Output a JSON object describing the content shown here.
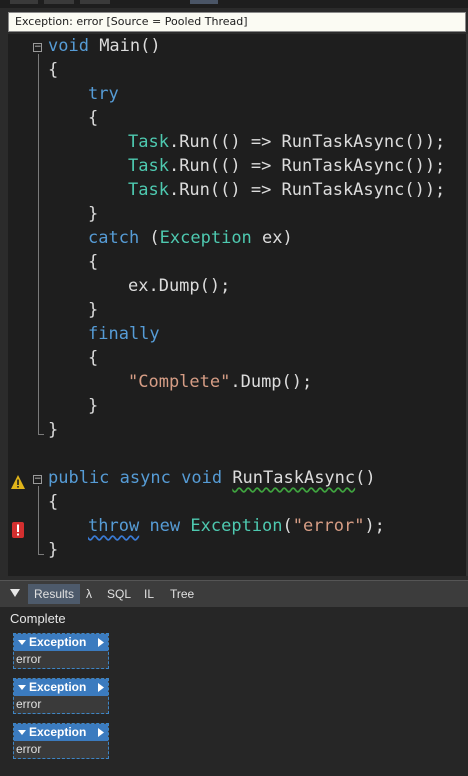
{
  "tooltip": {
    "text": "Exception: error [Source = Pooled Thread]"
  },
  "code": {
    "l1": [
      "void",
      " Main()"
    ],
    "l2": "{",
    "l3": "try",
    "l4": "{",
    "l5": [
      "Task",
      ".Run(() => RunTaskAsync());"
    ],
    "l6": [
      "Task",
      ".Run(() => RunTaskAsync());"
    ],
    "l7": [
      "Task",
      ".Run(() => RunTaskAsync());"
    ],
    "l8": "}",
    "l9": [
      "catch",
      " (",
      "Exception",
      " ex)"
    ],
    "l10": "{",
    "l11": "ex.Dump();",
    "l12": "}",
    "l13": "finally",
    "l14": "{",
    "l15": [
      "\"Complete\"",
      ".Dump();"
    ],
    "l16": "}",
    "l17": "}",
    "l18": [
      "public",
      " ",
      "async",
      " ",
      "void",
      " ",
      "RunTaskAsync",
      "()"
    ],
    "l19": "{",
    "l20": [
      "throw",
      " ",
      "new",
      " ",
      "Exception",
      "(",
      "\"error\"",
      ");"
    ],
    "l21": "}"
  },
  "panel": {
    "tabs": [
      "Results",
      "λ",
      "SQL",
      "IL",
      "Tree"
    ],
    "active_tab": "Results"
  },
  "results": {
    "status": "Complete",
    "items": [
      {
        "header": "Exception",
        "message": "error"
      },
      {
        "header": "Exception",
        "message": "error"
      },
      {
        "header": "Exception",
        "message": "error"
      }
    ]
  },
  "colors": {
    "keyword": "#569cd6",
    "type": "#4ec9b0",
    "string": "#d69d85",
    "accent": "#3b7bbf"
  }
}
